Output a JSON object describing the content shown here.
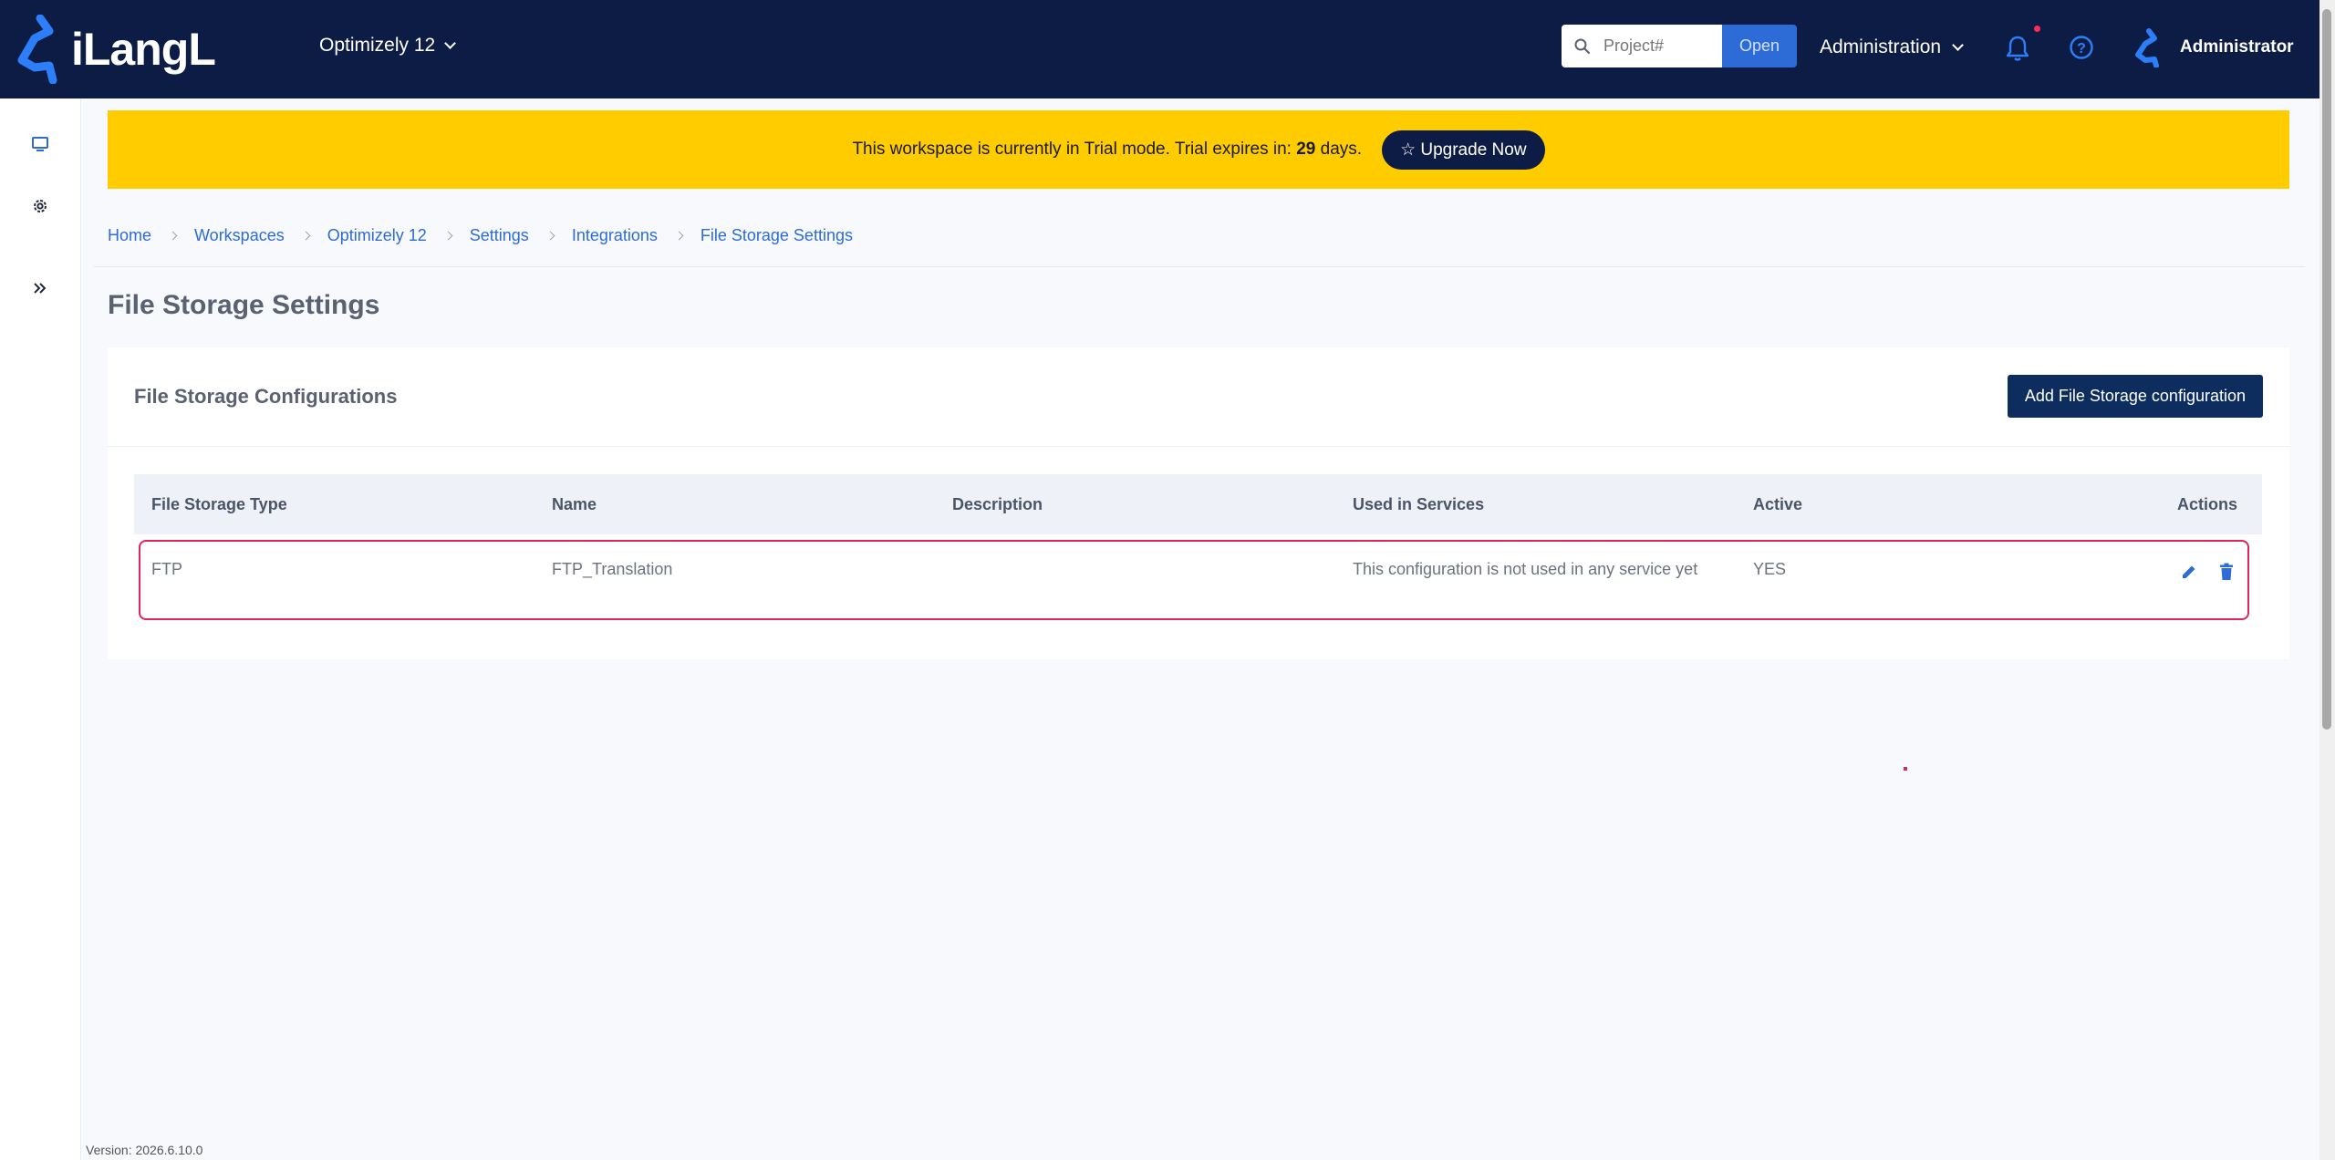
{
  "brand": {
    "logo_text": "iLangL"
  },
  "header": {
    "workspace": "Optimizely 12",
    "search_placeholder": "Project#",
    "open_label": "Open",
    "admin_menu": "Administration",
    "user_name": "Administrator"
  },
  "banner": {
    "text_before": "This workspace is currently in Trial mode. Trial expires in: ",
    "days": "29",
    "text_after": " days.",
    "upgrade_label": "☆ Upgrade Now"
  },
  "breadcrumb": [
    "Home",
    "Workspaces",
    "Optimizely 12",
    "Settings",
    "Integrations",
    "File Storage Settings"
  ],
  "page_title": "File Storage Settings",
  "card": {
    "title": "File Storage Configurations",
    "add_button": "Add File Storage configuration"
  },
  "table": {
    "headers": [
      "File Storage Type",
      "Name",
      "Description",
      "Used in Services",
      "Active",
      "Actions"
    ],
    "rows": [
      {
        "type": "FTP",
        "name": "FTP_Translation",
        "description": "",
        "used": "This configuration is not used in any service yet",
        "active": "YES"
      }
    ]
  },
  "version": "Version: 2026.6.10.0",
  "colors": {
    "topbar": "#0c1c44",
    "banner": "#ffcc00",
    "accent": "#2d6bd6",
    "highlight": "#e0245e"
  }
}
